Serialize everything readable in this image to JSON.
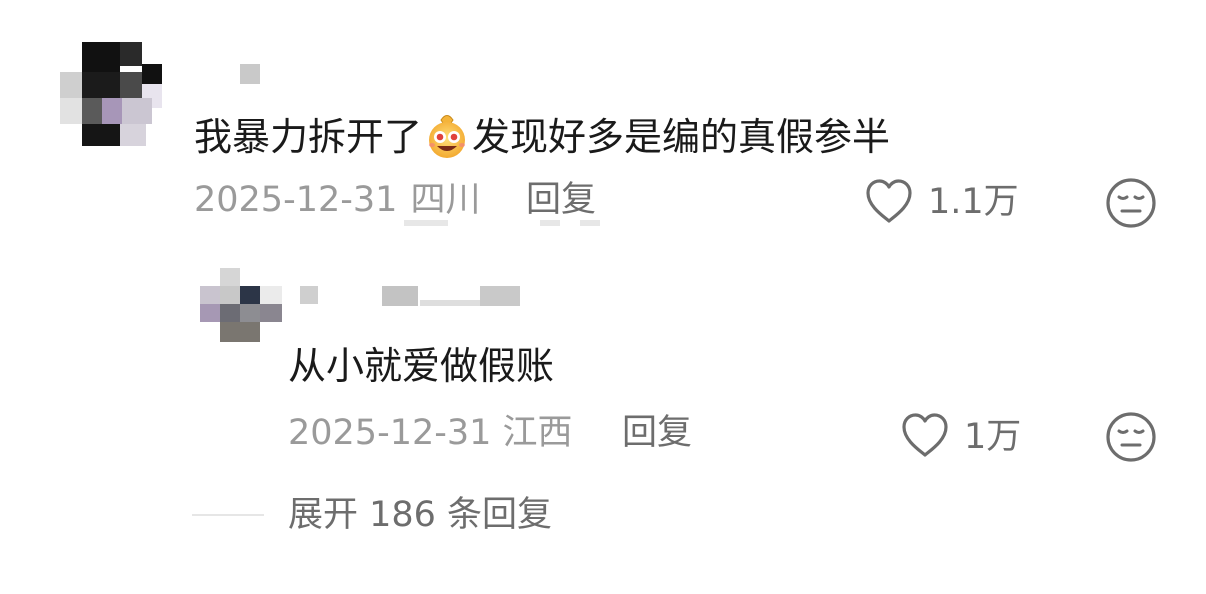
{
  "comments": [
    {
      "text_before": "我暴力拆开了",
      "emoji": "grinning-money-bag-emoji",
      "text_after": "发现好多是编的真假参半",
      "date": "2025-12-31",
      "location": "四川",
      "reply_label": "回复",
      "likes": "1.1万"
    }
  ],
  "reply": {
    "text": "从小就爱做假账",
    "date": "2025-12-31",
    "location": "江西",
    "reply_label": "回复",
    "likes": "1万"
  },
  "expand": {
    "label": "展开 186 条回复"
  },
  "icons": {
    "like": "heart-outline-icon",
    "dislike": "meh-face-icon"
  },
  "colors": {
    "text_primary": "#1a1a1a",
    "text_secondary": "#9a9a9a",
    "icon_gray": "#6d6d6d"
  }
}
